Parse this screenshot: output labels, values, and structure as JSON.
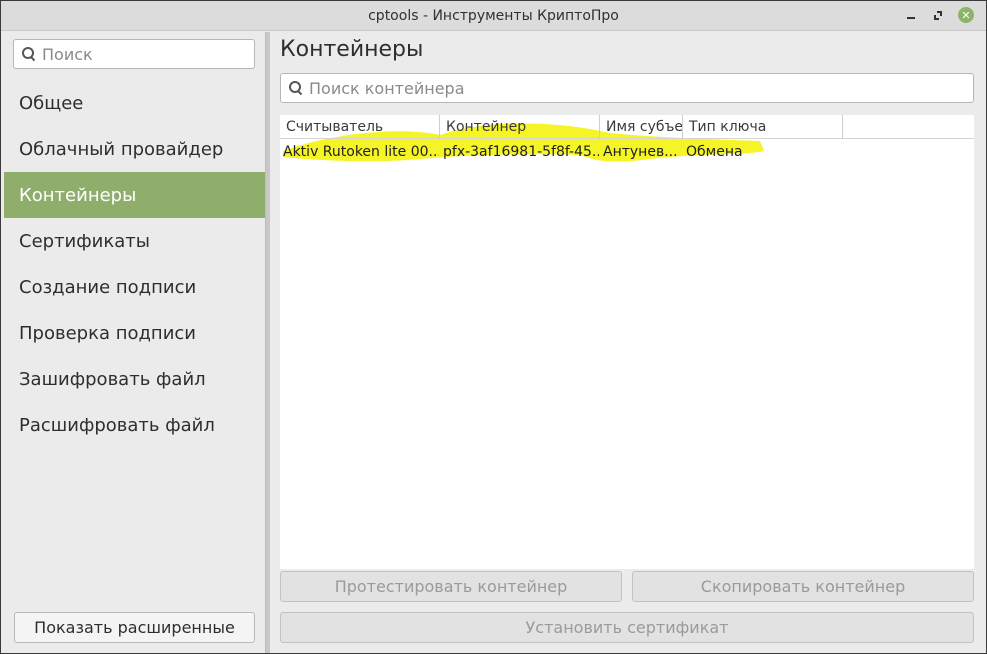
{
  "window": {
    "title": "cptools - Инструменты КриптоПро"
  },
  "sidebar": {
    "search_placeholder": "Поиск",
    "items": [
      {
        "label": "Общее"
      },
      {
        "label": "Облачный провайдер"
      },
      {
        "label": "Контейнеры",
        "active": true
      },
      {
        "label": "Сертификаты"
      },
      {
        "label": "Создание подписи"
      },
      {
        "label": "Проверка подписи"
      },
      {
        "label": "Зашифровать файл"
      },
      {
        "label": "Расшифровать файл"
      }
    ],
    "show_advanced_label": "Показать расширенные"
  },
  "main": {
    "title": "Контейнеры",
    "search_placeholder": "Поиск контейнера",
    "table": {
      "columns": [
        "Считыватель",
        "Контейнер",
        "Имя субъекта",
        "Тип ключа"
      ],
      "rows": [
        [
          "Aktiv Rutoken lite 00...",
          "pfx-3af16981-5f8f-45...",
          "Антунев...",
          "Обмена"
        ]
      ]
    },
    "buttons": {
      "test": "Протестировать контейнер",
      "copy": "Скопировать контейнер",
      "install": "Установить сертификат"
    }
  },
  "colors": {
    "accent": "#8fae6c",
    "close_button": "#8db569",
    "highlight": "#f2f200"
  },
  "icons": {
    "search": "magnifier"
  }
}
